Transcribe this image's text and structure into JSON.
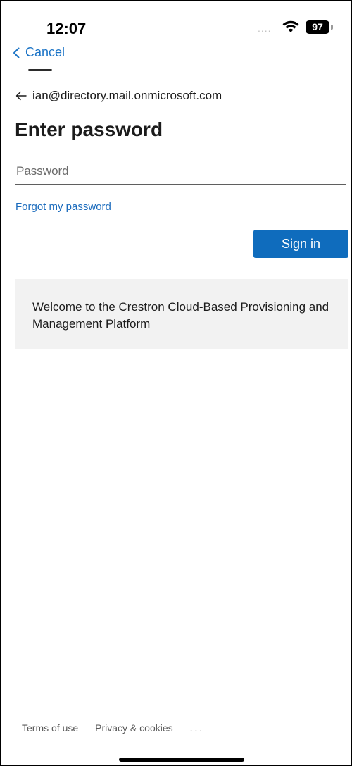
{
  "status_bar": {
    "time": "12:07",
    "signal": "....",
    "battery": "97"
  },
  "nav": {
    "cancel_label": "Cancel"
  },
  "identity": {
    "email": "ian@directory.mail.onmicrosoft.com"
  },
  "page": {
    "title": "Enter password"
  },
  "password_field": {
    "placeholder": "Password",
    "value": ""
  },
  "links": {
    "forgot": "Forgot my password"
  },
  "sign_in": {
    "label": "Sign in"
  },
  "banner": {
    "text": "Welcome to the Crestron Cloud-Based Provisioning and Management Platform"
  },
  "footer": {
    "terms": "Terms of use",
    "privacy": "Privacy & cookies",
    "more": "..."
  },
  "colors": {
    "accent": "#0f6cbd",
    "link": "#1a6bbd",
    "banner_bg": "#f2f2f2"
  },
  "icons": {
    "cancel": "chevron-left-icon",
    "back": "back-arrow-icon",
    "wifi": "wifi-icon",
    "battery": "battery-icon"
  }
}
